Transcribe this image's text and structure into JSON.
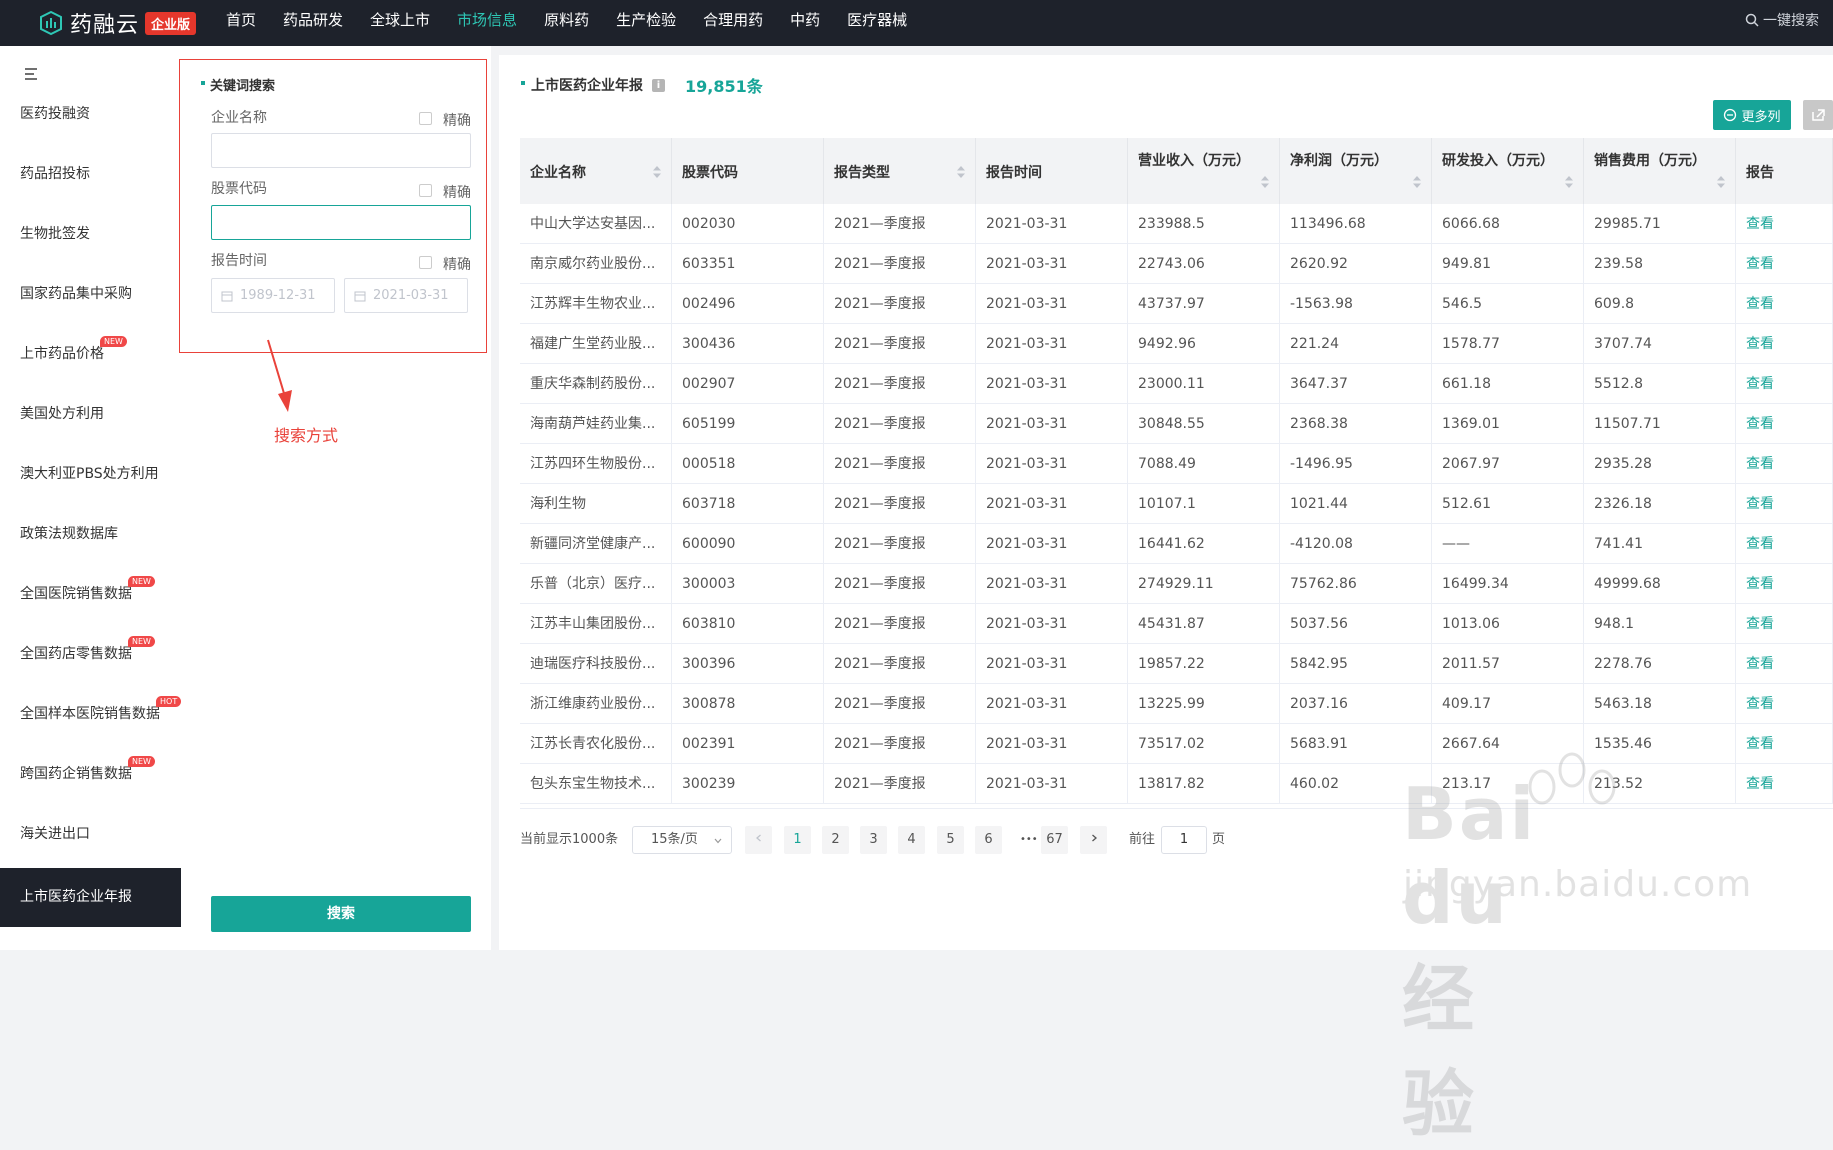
{
  "brand": {
    "name": "药融云",
    "badge": "企业版"
  },
  "nav": [
    "首页",
    "药品研发",
    "全球上市",
    "市场信息",
    "原料药",
    "生产检验",
    "合理用药",
    "中药",
    "医疗器械"
  ],
  "nav_active_index": 3,
  "top_search": "一键搜索",
  "sidebar": {
    "items": [
      {
        "label": "医药投融资",
        "tag": ""
      },
      {
        "label": "药品招投标",
        "tag": ""
      },
      {
        "label": "生物批签发",
        "tag": ""
      },
      {
        "label": "国家药品集中采购",
        "tag": ""
      },
      {
        "label": "上市药品价格",
        "tag": "NEW"
      },
      {
        "label": "美国处方利用",
        "tag": ""
      },
      {
        "label": "澳大利亚PBS处方利用",
        "tag": ""
      },
      {
        "label": "政策法规数据库",
        "tag": ""
      },
      {
        "label": "全国医院销售数据",
        "tag": "NEW"
      },
      {
        "label": "全国药店零售数据",
        "tag": "NEW"
      },
      {
        "label": "全国样本医院销售数据",
        "tag": "HOT"
      },
      {
        "label": "跨国药企销售数据",
        "tag": "NEW"
      },
      {
        "label": "海关进出口",
        "tag": ""
      },
      {
        "label": "上市医药企业年报",
        "tag": ""
      }
    ],
    "active_index": 13
  },
  "search_panel": {
    "title": "关键词搜索",
    "company_label": "企业名称",
    "stock_label": "股票代码",
    "date_label": "报告时间",
    "exact_label": "精确",
    "date_from": "1989-12-31",
    "date_to": "2021-03-31",
    "button": "搜索"
  },
  "annotation": "搜索方式",
  "main": {
    "title": "上市医药企业年报",
    "info": "i",
    "count": "19,851条",
    "more_columns": "更多列"
  },
  "table": {
    "columns": [
      "企业名称",
      "股票代码",
      "报告类型",
      "报告时间",
      "营业收入（万元）",
      "净利润（万元）",
      "研发投入（万元）",
      "销售费用（万元）",
      "报告"
    ],
    "rows": [
      [
        "中山大学达安基因...",
        "002030",
        "2021—季度报",
        "2021-03-31",
        "233988.5",
        "113496.68",
        "6066.68",
        "29985.71",
        "查看"
      ],
      [
        "南京威尔药业股份...",
        "603351",
        "2021—季度报",
        "2021-03-31",
        "22743.06",
        "2620.92",
        "949.81",
        "239.58",
        "查看"
      ],
      [
        "江苏辉丰生物农业...",
        "002496",
        "2021—季度报",
        "2021-03-31",
        "43737.97",
        "-1563.98",
        "546.5",
        "609.8",
        "查看"
      ],
      [
        "福建广生堂药业股...",
        "300436",
        "2021—季度报",
        "2021-03-31",
        "9492.96",
        "221.24",
        "1578.77",
        "3707.74",
        "查看"
      ],
      [
        "重庆华森制药股份...",
        "002907",
        "2021—季度报",
        "2021-03-31",
        "23000.11",
        "3647.37",
        "661.18",
        "5512.8",
        "查看"
      ],
      [
        "海南葫芦娃药业集...",
        "605199",
        "2021—季度报",
        "2021-03-31",
        "30848.55",
        "2368.38",
        "1369.01",
        "11507.71",
        "查看"
      ],
      [
        "江苏四环生物股份...",
        "000518",
        "2021—季度报",
        "2021-03-31",
        "7088.49",
        "-1496.95",
        "2067.97",
        "2935.28",
        "查看"
      ],
      [
        "海利生物",
        "603718",
        "2021—季度报",
        "2021-03-31",
        "10107.1",
        "1021.44",
        "512.61",
        "2326.18",
        "查看"
      ],
      [
        "新疆同济堂健康产...",
        "600090",
        "2021—季度报",
        "2021-03-31",
        "16441.62",
        "-4120.08",
        "——",
        "741.41",
        "查看"
      ],
      [
        "乐普（北京）医疗...",
        "300003",
        "2021—季度报",
        "2021-03-31",
        "274929.11",
        "75762.86",
        "16499.34",
        "49999.68",
        "查看"
      ],
      [
        "江苏丰山集团股份...",
        "603810",
        "2021—季度报",
        "2021-03-31",
        "45431.87",
        "5037.56",
        "1013.06",
        "948.1",
        "查看"
      ],
      [
        "迪瑞医疗科技股份...",
        "300396",
        "2021—季度报",
        "2021-03-31",
        "19857.22",
        "5842.95",
        "2011.57",
        "2278.76",
        "查看"
      ],
      [
        "浙江维康药业股份...",
        "300878",
        "2021—季度报",
        "2021-03-31",
        "13225.99",
        "2037.16",
        "409.17",
        "5463.18",
        "查看"
      ],
      [
        "江苏长青农化股份...",
        "002391",
        "2021—季度报",
        "2021-03-31",
        "73517.02",
        "5683.91",
        "2667.64",
        "1535.46",
        "查看"
      ],
      [
        "包头东宝生物技术...",
        "300239",
        "2021—季度报",
        "2021-03-31",
        "13817.82",
        "460.02",
        "213.17",
        "213.52",
        "查看"
      ]
    ]
  },
  "pagination": {
    "current_display": "当前显示1000条",
    "page_size": "15条/页",
    "pages": [
      "1",
      "2",
      "3",
      "4",
      "5",
      "6"
    ],
    "ellipsis": "•••",
    "last": "67",
    "active_page": "1",
    "goto_label": "前往",
    "goto_value": "1",
    "page_suffix": "页"
  },
  "watermark": {
    "logo": "Bai du 经验",
    "url": "jingyan.baidu.com"
  },
  "colors": {
    "accent": "#17a598",
    "topbar": "#1e222b",
    "annotation": "#e9423a"
  }
}
